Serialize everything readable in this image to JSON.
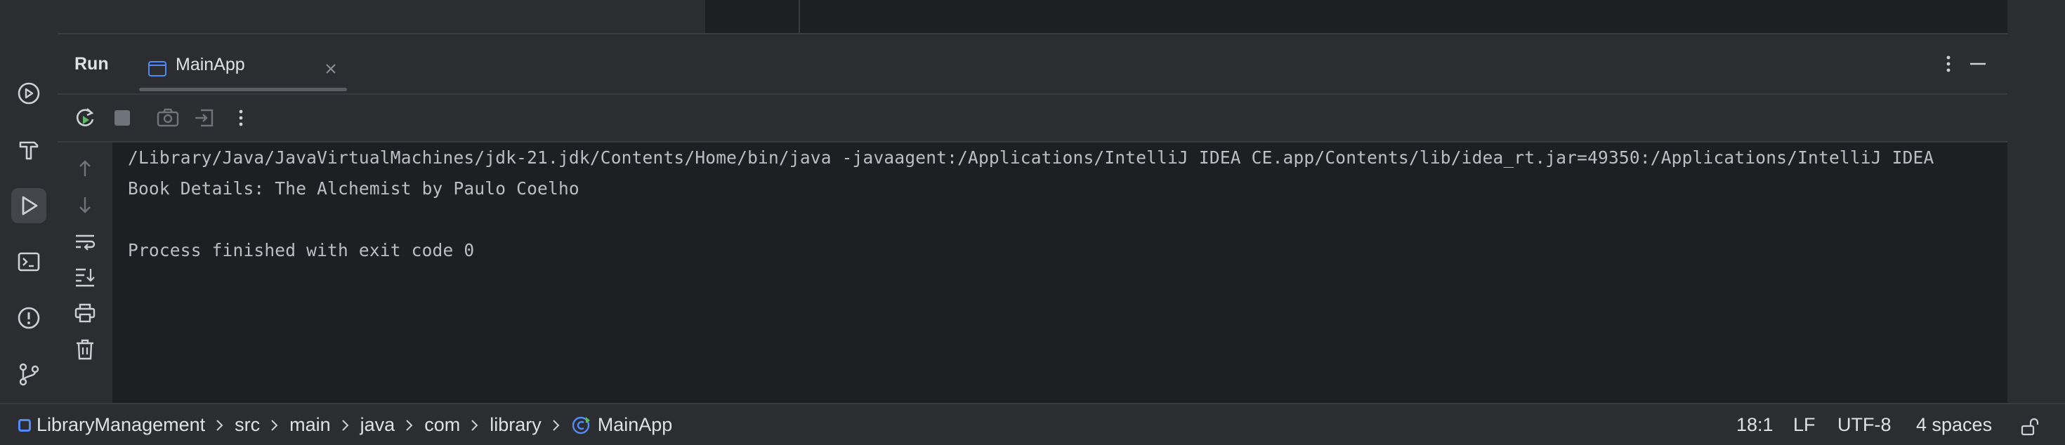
{
  "run_panel": {
    "title": "Run",
    "tab": {
      "label": "MainApp"
    }
  },
  "console": {
    "lines": [
      "/Library/Java/JavaVirtualMachines/jdk-21.jdk/Contents/Home/bin/java -javaagent:/Applications/IntelliJ IDEA CE.app/Contents/lib/idea_rt.jar=49350:/Applications/IntelliJ IDEA",
      "Book Details: The Alchemist by Paulo Coelho",
      "",
      "Process finished with exit code 0"
    ]
  },
  "left_strip_icons": [
    "services-icon",
    "build-icon",
    "run-icon",
    "terminal-icon",
    "problems-icon",
    "git-icon"
  ],
  "toolbar_icons": [
    "rerun-icon",
    "stop-icon",
    "screenshot-icon",
    "restore-layout-icon",
    "more-icon"
  ],
  "console_side_icons": [
    "up-arrow-icon",
    "down-arrow-icon",
    "soft-wrap-icon",
    "scroll-to-end-icon",
    "print-icon",
    "trash-icon"
  ],
  "statusbar": {
    "breadcrumbs": [
      "LibraryManagement",
      "src",
      "main",
      "java",
      "com",
      "library",
      "MainApp"
    ],
    "position": "18:1",
    "line_separator": "LF",
    "encoding": "UTF-8",
    "indent": "4 spaces"
  },
  "colors": {
    "background": "#1e1f22",
    "panel": "#2b2d30",
    "text": "#dfe1e5",
    "console_text": "#bcbec4",
    "accent_blue": "#548af7",
    "run_green": "#5fb865"
  }
}
